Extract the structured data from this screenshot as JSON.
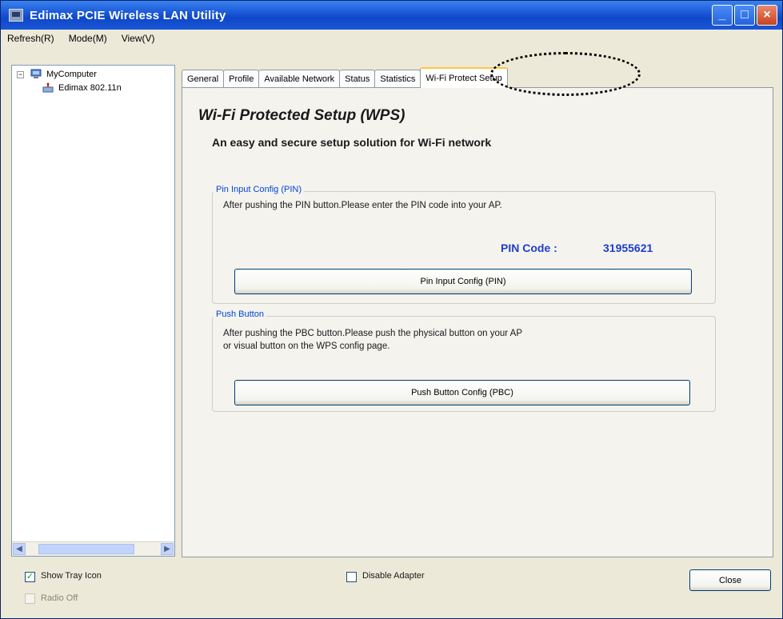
{
  "window": {
    "title": "Edimax PCIE Wireless LAN Utility",
    "buttons": {
      "minimize": "_",
      "maximize": "□",
      "close": "×"
    }
  },
  "menu": [
    "Refresh(R)",
    "Mode(M)",
    "View(V)"
  ],
  "tree": {
    "root_label": "MyComputer",
    "root_expander": "−",
    "child_label": "Edimax 802.11n"
  },
  "tabs": [
    "General",
    "Profile",
    "Available Network",
    "Status",
    "Statistics",
    "Wi-Fi Protect Setup"
  ],
  "active_tab_index": 5,
  "wps": {
    "title": "Wi-Fi Protected Setup (WPS)",
    "subtitle": "An easy and secure setup solution for Wi-Fi network",
    "pin_group": {
      "legend": "Pin Input Config (PIN)",
      "description": "After pushing the PIN button.Please enter the PIN code into your AP.",
      "pin_label": "PIN Code :",
      "pin_value": "31955621",
      "button_label": "Pin Input Config (PIN)"
    },
    "pbc_group": {
      "legend": "Push Button",
      "description_line1": "After pushing the PBC button.Please push the physical button on your AP",
      "description_line2": "or visual button on the WPS config page.",
      "button_label": "Push Button Config (PBC)"
    }
  },
  "bottom": {
    "show_tray_icon": {
      "label": "Show Tray Icon",
      "checked": true,
      "check_glyph": "✓"
    },
    "radio_off": {
      "label": "Radio Off",
      "checked": false,
      "disabled": true
    },
    "disable_adapter": {
      "label": "Disable Adapter",
      "checked": false
    },
    "close_button": "Close"
  },
  "colors": {
    "titlebar": "#0f48c8",
    "window_bg": "#ece9d8",
    "link_blue": "#1f3ec9",
    "legend_blue": "#0046d5",
    "tab_active_accent": "#ffc83c"
  }
}
